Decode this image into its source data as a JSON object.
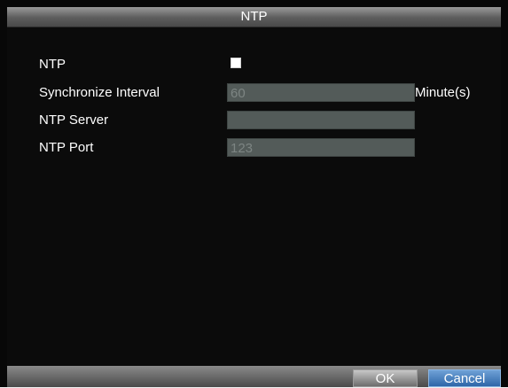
{
  "window": {
    "title": "NTP"
  },
  "form": {
    "ntp_label": "NTP",
    "ntp_checked": true,
    "sync_interval_label": "Synchronize Interval",
    "sync_interval_value": "60",
    "sync_interval_unit": "Minute(s)",
    "ntp_server_label": "NTP Server",
    "ntp_server_value": "",
    "ntp_port_label": "NTP Port",
    "ntp_port_value": "123"
  },
  "buttons": {
    "ok_label": "OK",
    "cancel_label": "Cancel"
  }
}
